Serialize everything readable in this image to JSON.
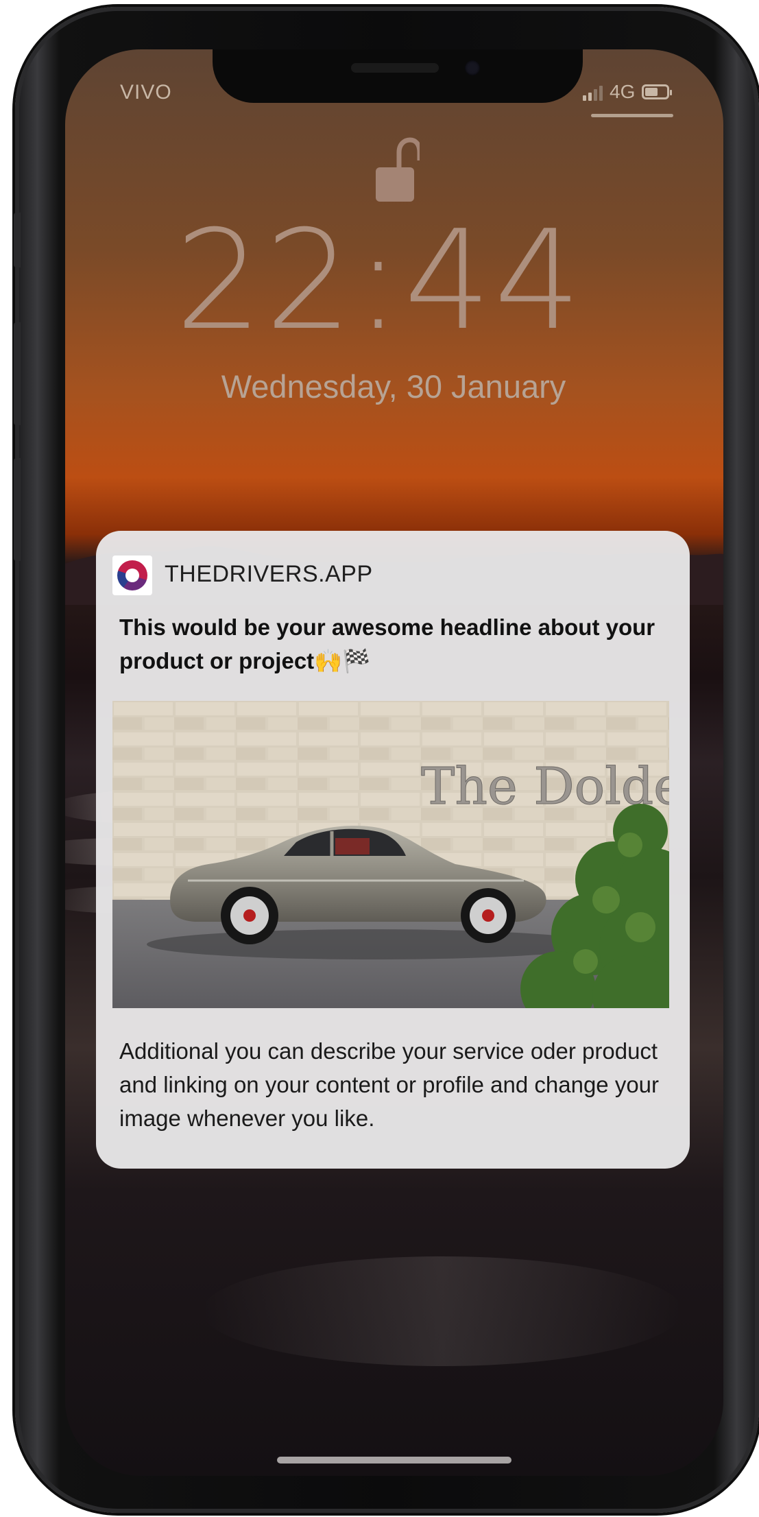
{
  "status_bar": {
    "carrier": "VIVO",
    "network": "4G",
    "signal_bars": 2,
    "battery_icon": "battery-icon"
  },
  "lock_screen": {
    "lock_icon": "unlocked-padlock-icon",
    "time": "22:44",
    "date": "Wednesday, 30 January"
  },
  "notification": {
    "app_icon": "thedrivers-logo-icon",
    "app_name": "THEDRIVERS.APP",
    "headline": "This would be your awesome headline about your product or project🙌🏁",
    "image_sign_text": "The Dolder",
    "body": "Additional you can describe your service oder product and linking on your content or profile and change your image whenever you like."
  },
  "colors": {
    "notification_bg": "#e8e7e8",
    "sky_orange": "#bc4e13",
    "clock_text": "#ad8f7d"
  }
}
